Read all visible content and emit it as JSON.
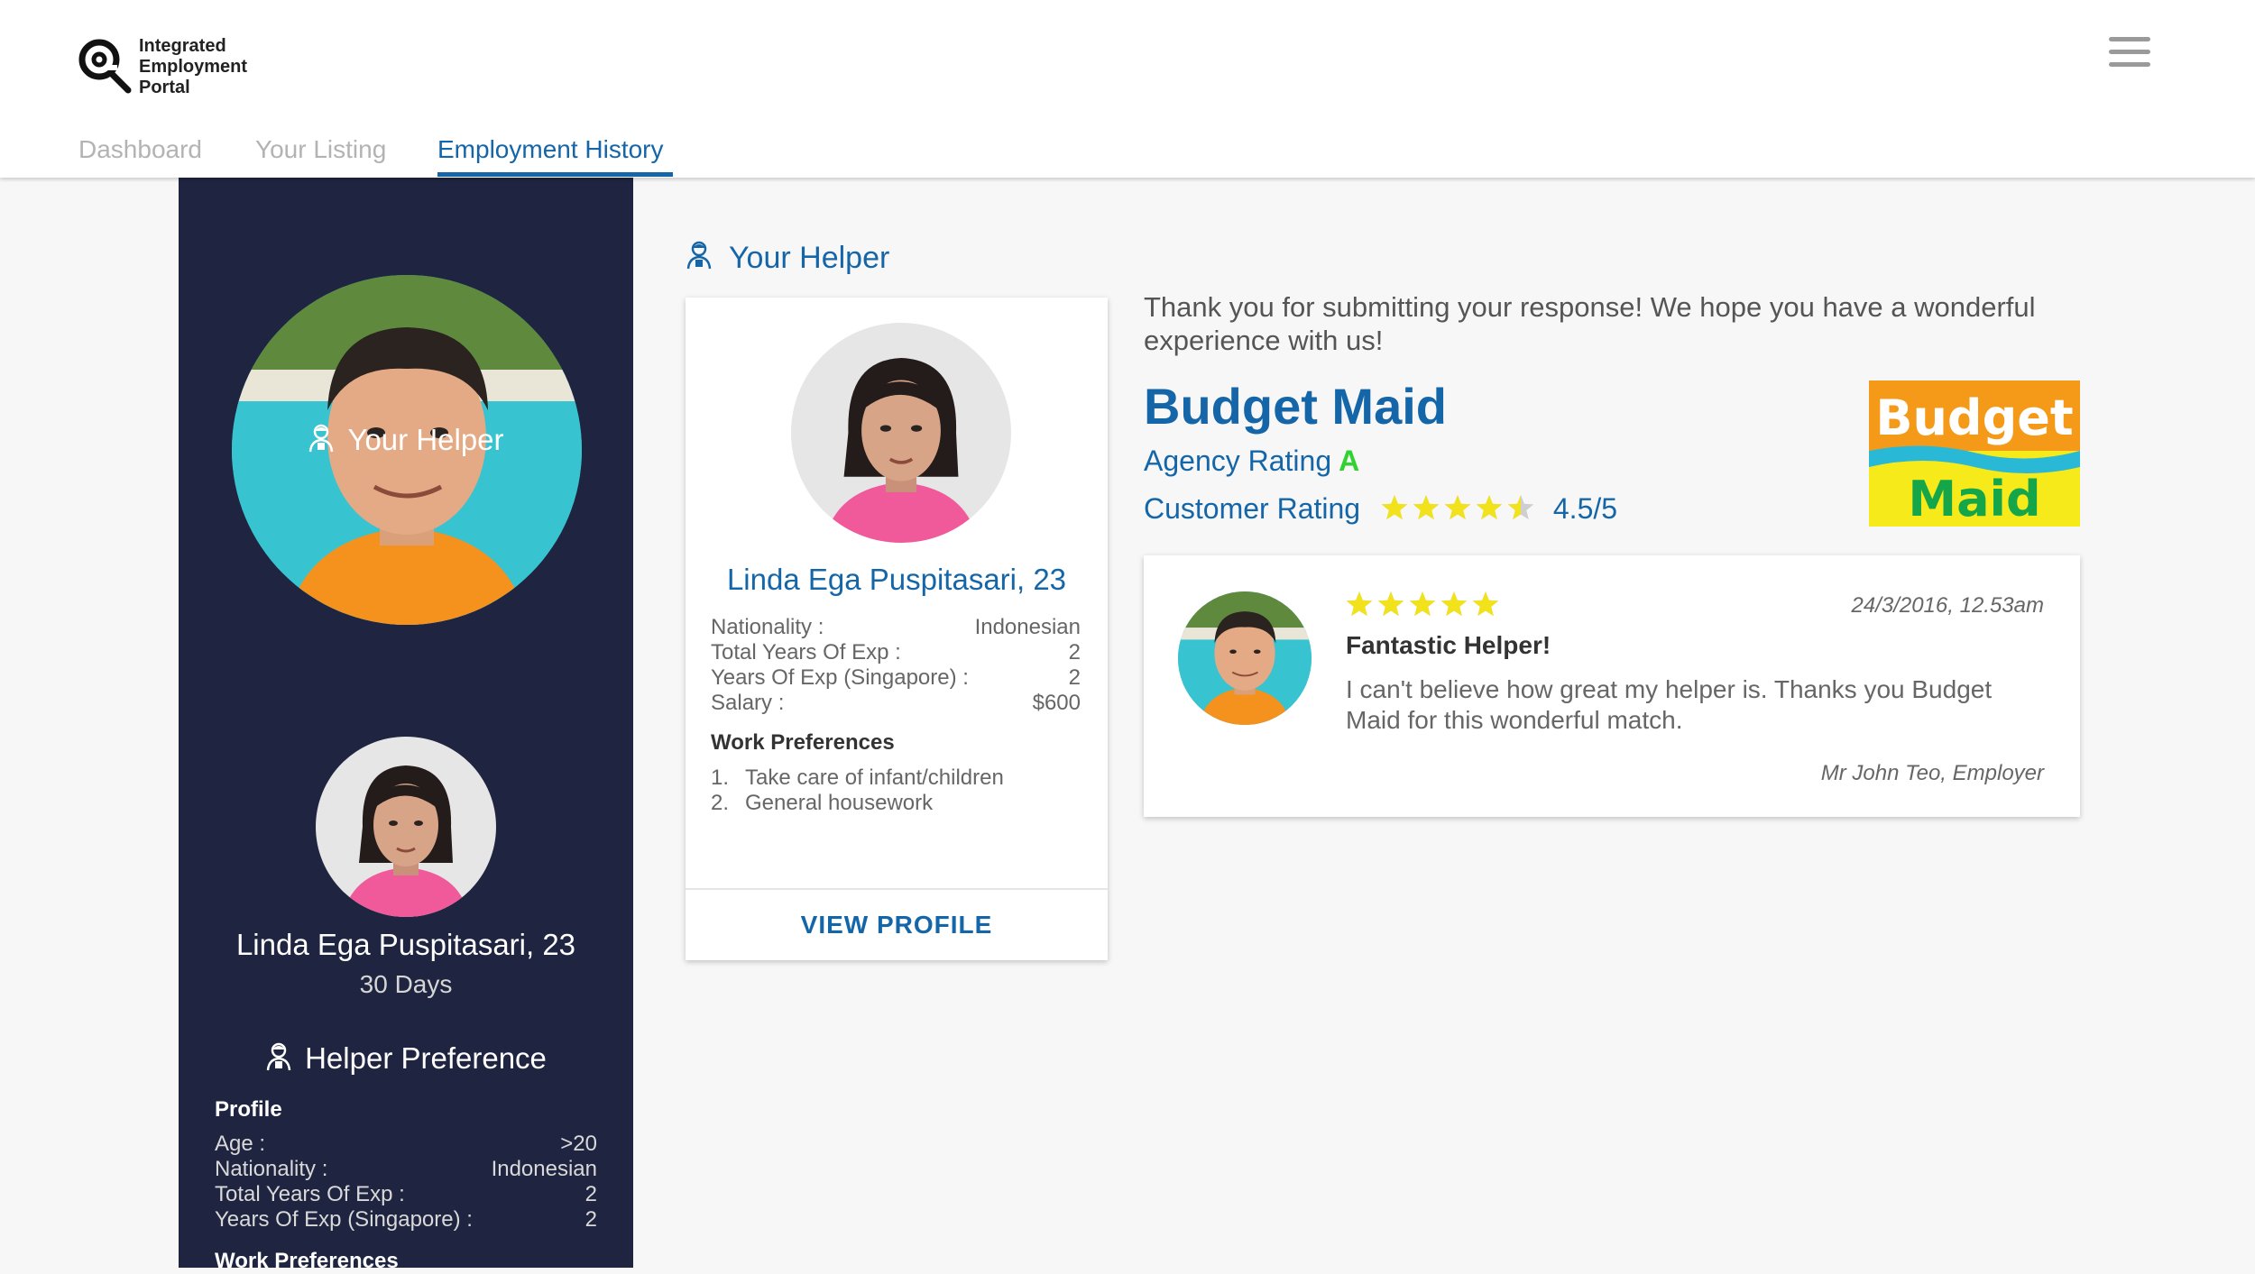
{
  "logo": {
    "line1": "Integrated",
    "line2": "Employment",
    "line3": "Portal"
  },
  "nav": {
    "tabs": [
      {
        "label": "Dashboard",
        "active": false
      },
      {
        "label": "Your Listing",
        "active": false
      },
      {
        "label": "Employment History",
        "active": true
      }
    ],
    "menu_icon": "hamburger-menu-icon"
  },
  "sidebar": {
    "your_helper_title": "Your Helper",
    "helper_name": "Linda Ega Puspitasari, 23",
    "helper_days": "30 Days",
    "helper_preference_title": "Helper Preference",
    "profile_title": "Profile",
    "profile": [
      {
        "label": "Age :",
        "value": ">20"
      },
      {
        "label": "Nationality :",
        "value": "Indonesian"
      },
      {
        "label": "Total Years Of Exp :",
        "value": "2"
      },
      {
        "label": "Years Of Exp (Singapore) :",
        "value": "2"
      }
    ],
    "work_preferences_title": "Work Preferences"
  },
  "main": {
    "section_title": "Your Helper",
    "helper_card": {
      "name": "Linda Ega Puspitasari, 23",
      "details": [
        {
          "label": "Nationality :",
          "value": "Indonesian"
        },
        {
          "label": "Total Years Of Exp :",
          "value": "2"
        },
        {
          "label": "Years Of Exp (Singapore) :",
          "value": "2"
        },
        {
          "label": "Salary :",
          "value": "$600"
        }
      ],
      "work_preferences_title": "Work Preferences",
      "work_preferences": [
        {
          "num": "1.",
          "text": "Take care of infant/children"
        },
        {
          "num": "2.",
          "text": "General housework"
        }
      ],
      "button_label": "VIEW PROFILE"
    },
    "thanks_message": "Thank you for submitting your response! We hope you have a wonderful experience with us!",
    "agency": {
      "name": "Budget Maid",
      "rating_label": "Agency Rating",
      "rating_grade": "A",
      "customer_rating_label": "Customer Rating",
      "customer_rating": 4.5,
      "customer_rating_text": "4.5/5",
      "logo_line1": "Budget",
      "logo_line2": "Maid"
    },
    "review": {
      "stars": 5,
      "date": "24/3/2016, 12.53am",
      "title": "Fantastic Helper!",
      "body": "I can't believe how great my helper is. Thanks you Budget Maid for this wonderful match.",
      "author": "Mr John Teo, Employer"
    }
  },
  "colors": {
    "brand_blue": "#1466a8",
    "sidebar_bg": "#1f2440",
    "star_yellow": "#f2e21b",
    "grade_green": "#2fd22f"
  }
}
